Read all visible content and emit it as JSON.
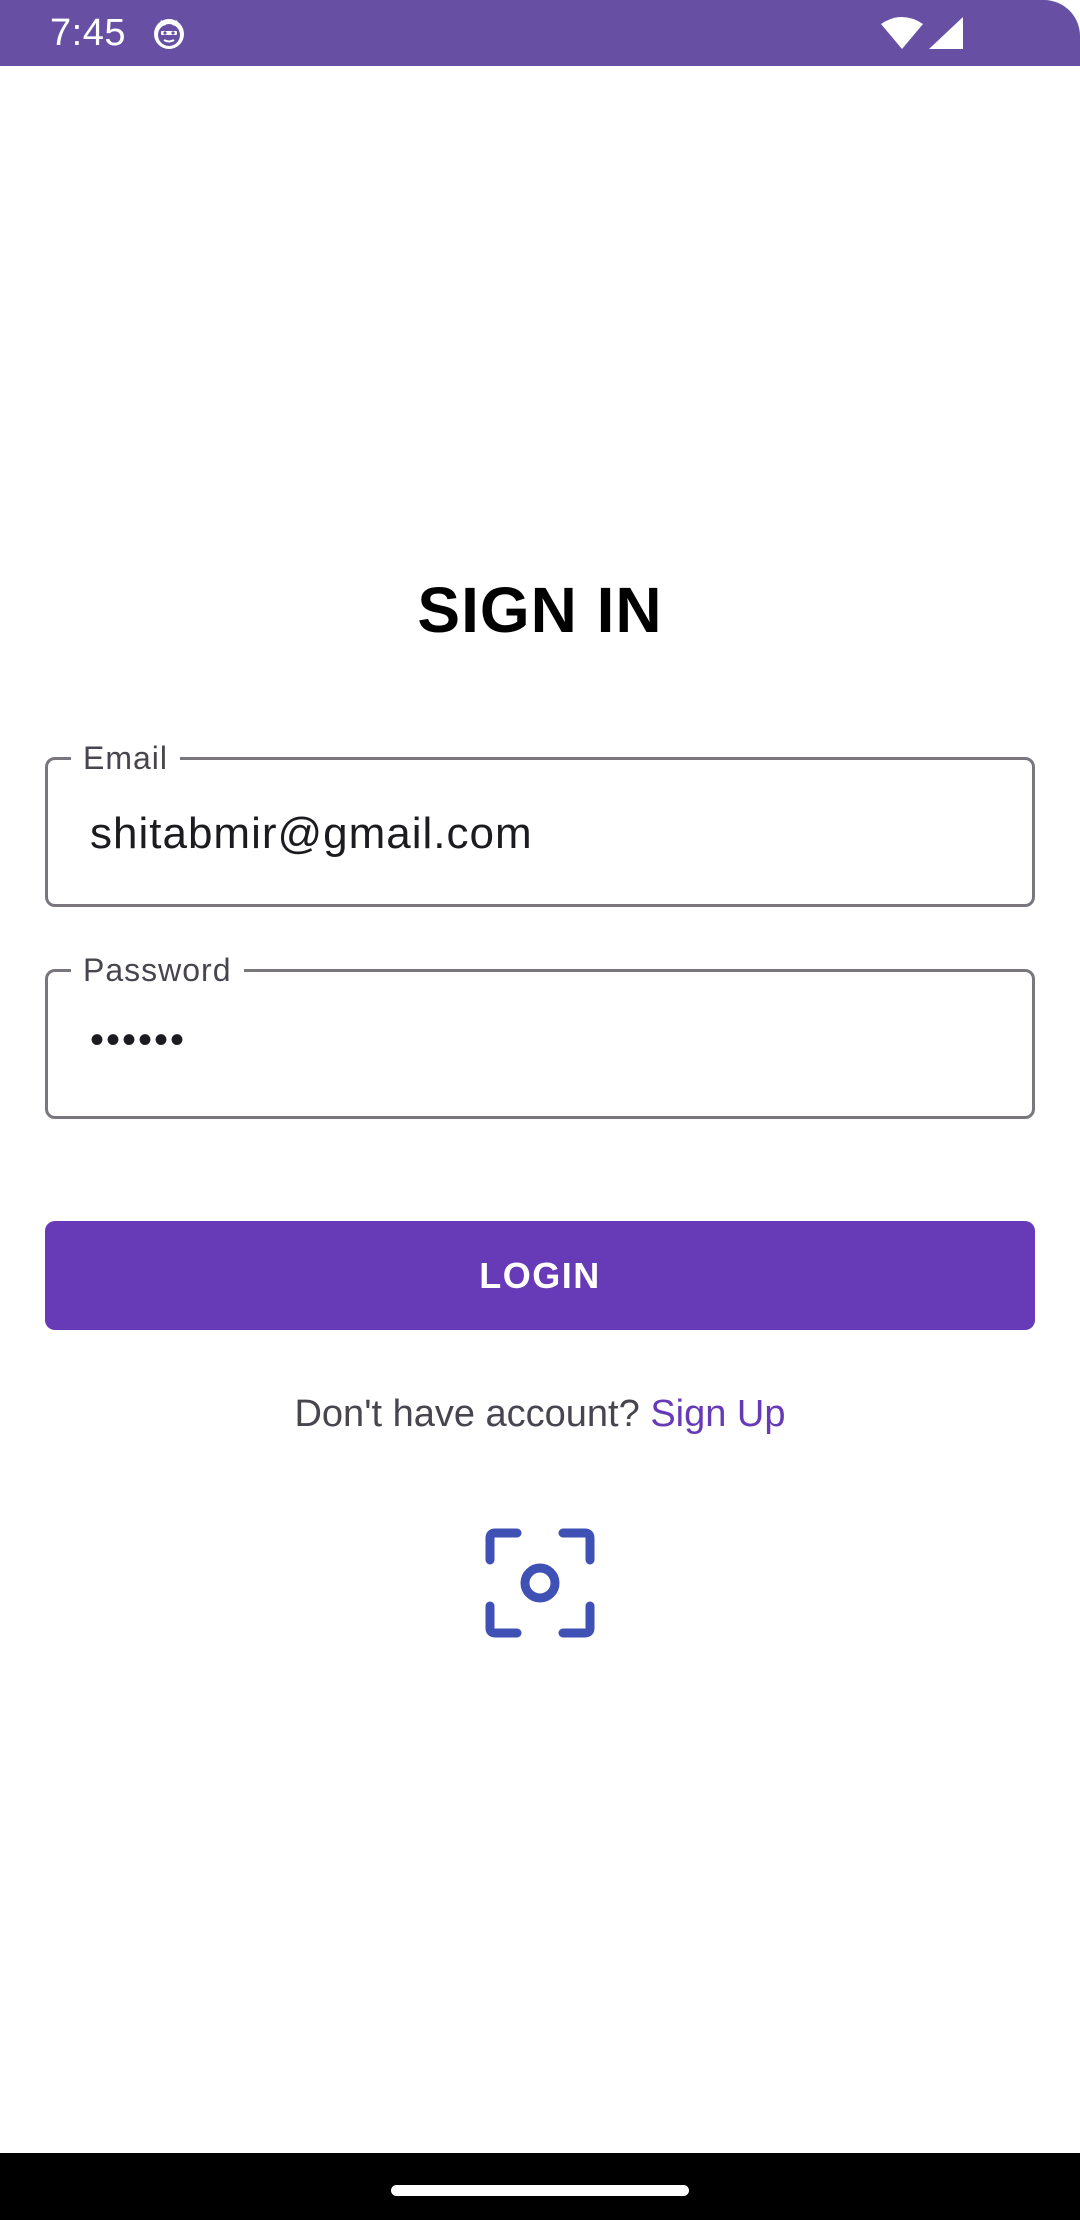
{
  "status_bar": {
    "time": "7:45",
    "app_icon": "cat-face-icon",
    "wifi_icon": "wifi-icon",
    "signal_icon": "cell-signal-icon",
    "color": "#6750a4"
  },
  "screen": {
    "title": "SIGN IN"
  },
  "form": {
    "email": {
      "label": "Email",
      "value": "shitabmir@gmail.com"
    },
    "password": {
      "label": "Password",
      "value": "••••••"
    },
    "login_label": "LOGIN",
    "accent_color": "#673ab7"
  },
  "signup": {
    "prompt": "Don't have account?",
    "link_label": "Sign Up"
  },
  "scan": {
    "icon": "face-scan-icon",
    "color": "#3f51b5"
  }
}
